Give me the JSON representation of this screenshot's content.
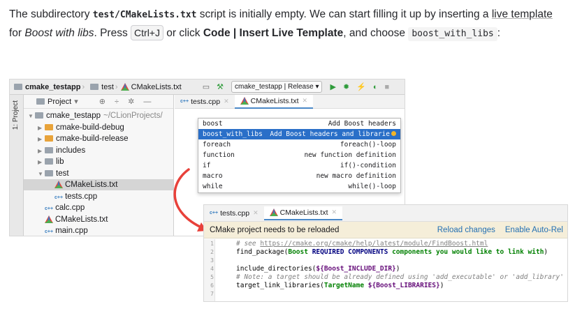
{
  "intro": {
    "t1": "The subdirectory ",
    "file": "test/CMakeLists.txt",
    "t2": " script is initially empty. We can start filling it up by inserting a ",
    "link": "live template",
    "t3": " for ",
    "italic": "Boost with libs",
    "t4": ". Press ",
    "kbd": "Ctrl+J",
    "t5": " or click ",
    "menu": "Code | Insert Live Template",
    "t6": ", and choose ",
    "template": "boost_with_libs",
    "t7": ":"
  },
  "ide": {
    "breadcrumb": [
      "cmake_testapp",
      "test",
      "CMakeLists.txt"
    ],
    "run_config": "cmake_testapp | Release",
    "side_tab": "1: Project",
    "project_dropdown": "Project",
    "tree": [
      {
        "label": "cmake_testapp",
        "hint": "~/CLionProjects/",
        "kind": "folder-gray",
        "depth": 0,
        "tri": "▼"
      },
      {
        "label": "cmake-build-debug",
        "kind": "folder-orange",
        "depth": 1,
        "tri": "▶"
      },
      {
        "label": "cmake-build-release",
        "kind": "folder-orange",
        "depth": 1,
        "tri": "▶"
      },
      {
        "label": "includes",
        "kind": "folder-gray",
        "depth": 1,
        "tri": "▶"
      },
      {
        "label": "lib",
        "kind": "folder-gray",
        "depth": 1,
        "tri": "▶"
      },
      {
        "label": "test",
        "kind": "folder-gray",
        "depth": 1,
        "tri": "▼"
      },
      {
        "label": "CMakeLists.txt",
        "kind": "cmake",
        "depth": 2,
        "tri": "",
        "selected": true
      },
      {
        "label": "tests.cpp",
        "kind": "cpp",
        "depth": 2,
        "tri": ""
      },
      {
        "label": "calc.cpp",
        "kind": "cpp",
        "depth": 1,
        "tri": ""
      },
      {
        "label": "CMakeLists.txt",
        "kind": "cmake",
        "depth": 1,
        "tri": ""
      },
      {
        "label": "main.cpp",
        "kind": "cpp",
        "depth": 1,
        "tri": ""
      }
    ],
    "tabs": [
      "tests.cpp",
      "CMakeLists.txt"
    ],
    "popup": [
      {
        "name": "boost",
        "desc": "Add Boost headers"
      },
      {
        "name": "boost_with_libs",
        "desc": "Add Boost headers and librarie",
        "selected": true
      },
      {
        "name": "foreach",
        "desc": "foreach()-loop"
      },
      {
        "name": "function",
        "desc": "new function definition"
      },
      {
        "name": "if",
        "desc": "if()-condition"
      },
      {
        "name": "macro",
        "desc": "new macro definition"
      },
      {
        "name": "while",
        "desc": "while()-loop"
      }
    ]
  },
  "ide2": {
    "tabs": [
      "tests.cpp",
      "CMakeLists.txt"
    ],
    "banner": "CMake project needs to be reloaded",
    "reload": "Reload changes",
    "auto": "Enable Auto-Rel",
    "line_numbers": [
      "1",
      "2",
      "3",
      "4",
      "5",
      "6",
      "7"
    ],
    "code": {
      "l1_prefix": "# see ",
      "l1_url": "https://cmake.org/cmake/help/latest/module/FindBoost.html",
      "l2_fn": "find_package(",
      "l2_boost": "Boost ",
      "l2_kw": "REQUIRED COMPONENTS ",
      "l2_str": "components you would like to link with",
      "l2_end": ")",
      "l4_fn": "include_directories(",
      "l4_var": "${Boost_INCLUDE_DIR}",
      "l4_end": ")",
      "l5": "# Note: a target should be already defined using 'add_executable' or 'add_library'",
      "l6_fn": "target_link_libraries(",
      "l6_str": "TargetName ",
      "l6_var": "${Boost_LIBRARIES}",
      "l6_end": ")"
    }
  },
  "colors": {
    "selection": "#2a6fc8",
    "arrow": "#e8413a",
    "banner": "#f5eed9",
    "link": "#2470b3"
  }
}
